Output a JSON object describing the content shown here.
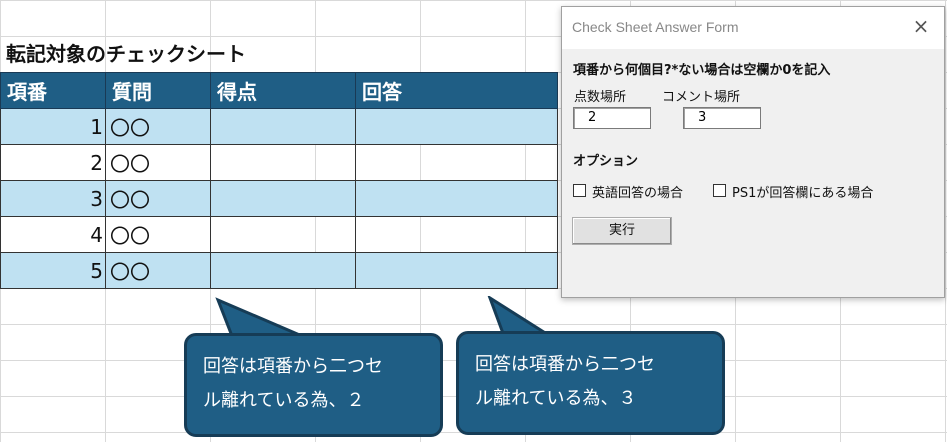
{
  "sheet": {
    "title": "転記対象のチェックシート",
    "headers": [
      "項番",
      "質問",
      "得点",
      "回答"
    ],
    "rows": [
      {
        "no": "1",
        "question": "〇〇",
        "score": "",
        "answer": ""
      },
      {
        "no": "2",
        "question": "〇〇",
        "score": "",
        "answer": ""
      },
      {
        "no": "3",
        "question": "〇〇",
        "score": "",
        "answer": ""
      },
      {
        "no": "4",
        "question": "〇〇",
        "score": "",
        "answer": ""
      },
      {
        "no": "5",
        "question": "〇〇",
        "score": "",
        "answer": ""
      }
    ]
  },
  "dialog": {
    "title": "Check Sheet Answer Form",
    "close_icon": "×",
    "heading": "項番から何個目?*ない場合は空欄か0を記入",
    "score_label": "点数場所",
    "score_value": "2",
    "comment_label": "コメント場所",
    "comment_value": "3",
    "options_heading": "オプション",
    "option_english": "英語回答の場合",
    "option_ps1": "PS1が回答欄にある場合",
    "execute_label": "実行"
  },
  "callouts": [
    {
      "line1": "回答は項番から二つセ",
      "line2": "ル離れている為、２"
    },
    {
      "line1": "回答は項番から二つセ",
      "line2": "ル離れている為、３"
    }
  ],
  "colors": {
    "header": "#1f5e85",
    "alt_row": "#bfe1f2",
    "callout": "#1f5e85"
  }
}
